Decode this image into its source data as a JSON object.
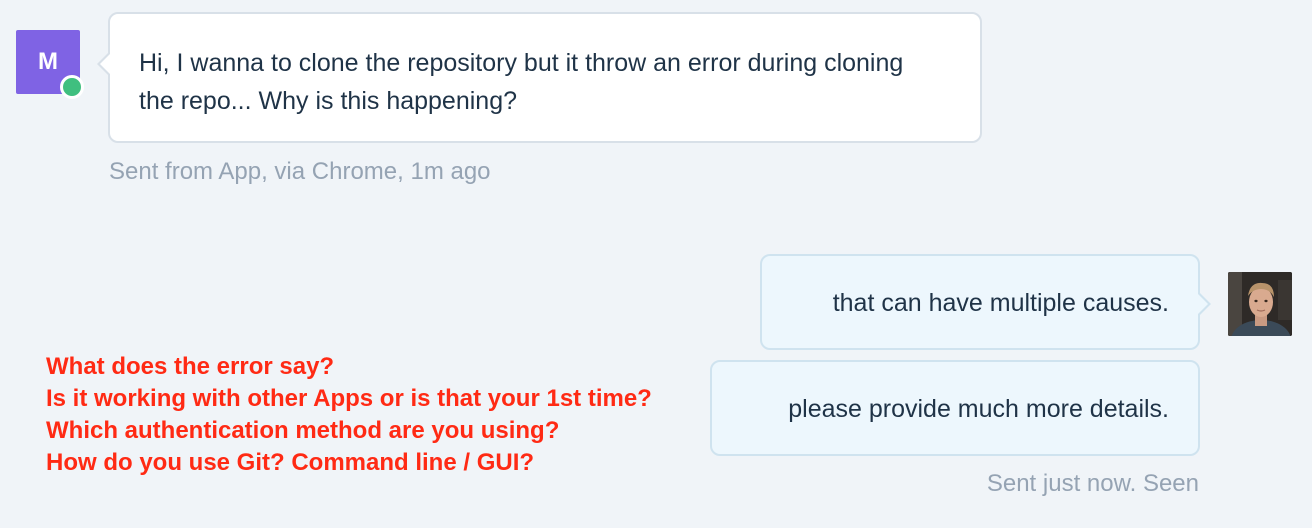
{
  "incoming": {
    "avatar_initial": "M",
    "avatar_color": "#7f63e4",
    "online_status_color": "#3fbf7f",
    "message": "Hi, I wanna to clone the repository but it throw an error during cloning the repo... Why is this happening?",
    "meta": "Sent from App, via Chrome, 1m ago"
  },
  "outgoing": {
    "messages": [
      "that can have multiple causes.",
      "please provide much more details."
    ],
    "meta": "Sent just now. Seen",
    "avatar_icon": "user-photo"
  },
  "annotation": {
    "color": "#ff2a14",
    "lines": [
      "What does the error say?",
      "Is it working with other Apps or is that your 1st time?",
      "Which authentication method are you using?",
      "How do you use Git? Command line / GUI?"
    ]
  },
  "colors": {
    "background": "#f0f4f8",
    "incoming_bubble": "#ffffff",
    "outgoing_bubble": "#edf7fd",
    "text": "#1f3347",
    "meta_text": "#95a3b3"
  }
}
